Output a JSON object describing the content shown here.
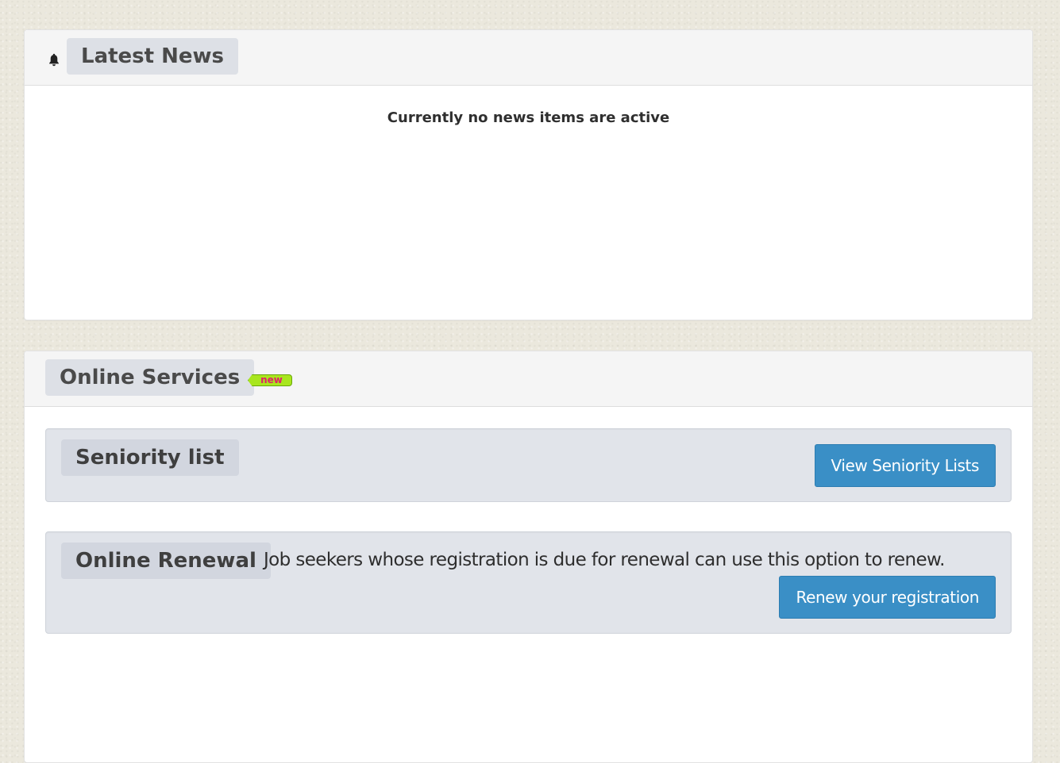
{
  "news": {
    "title": "Latest News",
    "empty_message": "Currently no news items are active"
  },
  "services": {
    "title": "Online Services",
    "badge": "new",
    "seniority": {
      "title": "Seniority list",
      "button": "View Seniority Lists"
    },
    "renewal": {
      "title": "Online Renewal",
      "description": "Job seekers whose registration is due for renewal can use this option to renew.",
      "button": "Renew your registration"
    }
  },
  "icons": {
    "news": "bell-icon"
  },
  "colors": {
    "page_background": "#ebe8dd",
    "panel_heading": "#f5f5f5",
    "chip": "#dde0e6",
    "well": "#e1e4ea",
    "button": "#3a8fc6",
    "badge": "#a8e61e",
    "badge_text": "#e0206a"
  }
}
